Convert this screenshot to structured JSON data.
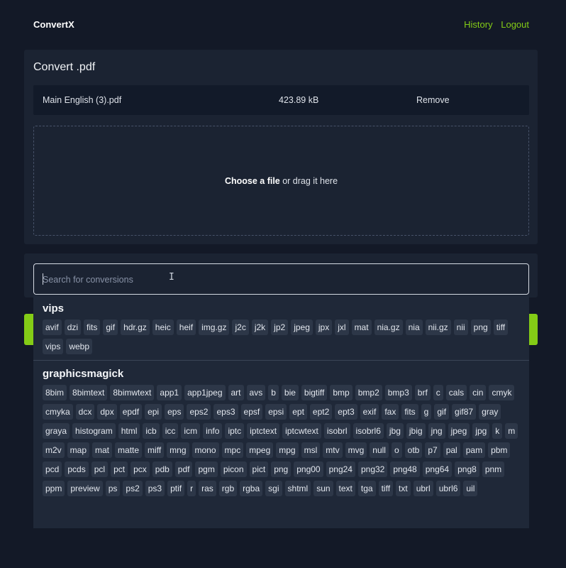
{
  "app": {
    "name": "ConvertX"
  },
  "nav": {
    "history": "History",
    "logout": "Logout"
  },
  "convert": {
    "title": "Convert .pdf",
    "file": {
      "name": "Main English (3).pdf",
      "size": "423.89 kB",
      "remove": "Remove"
    },
    "drop": {
      "choose": "Choose a file",
      "rest": " or drag it here"
    }
  },
  "search": {
    "placeholder": "Search for conversions"
  },
  "colors": {
    "accent": "#84cc16",
    "background": "#131927",
    "panel": "#1b2332"
  },
  "groups": [
    {
      "name": "vips",
      "formats": [
        "avif",
        "dzi",
        "fits",
        "gif",
        "hdr.gz",
        "heic",
        "heif",
        "img.gz",
        "j2c",
        "j2k",
        "jp2",
        "jpeg",
        "jpx",
        "jxl",
        "mat",
        "nia.gz",
        "nia",
        "nii.gz",
        "nii",
        "png",
        "tiff",
        "vips",
        "webp"
      ]
    },
    {
      "name": "graphicsmagick",
      "formats": [
        "8bim",
        "8bimtext",
        "8bimwtext",
        "app1",
        "app1jpeg",
        "art",
        "avs",
        "b",
        "bie",
        "bigtiff",
        "bmp",
        "bmp2",
        "bmp3",
        "brf",
        "c",
        "cals",
        "cin",
        "cmyk",
        "cmyka",
        "dcx",
        "dpx",
        "epdf",
        "epi",
        "eps",
        "eps2",
        "eps3",
        "epsf",
        "epsi",
        "ept",
        "ept2",
        "ept3",
        "exif",
        "fax",
        "fits",
        "g",
        "gif",
        "gif87",
        "gray",
        "graya",
        "histogram",
        "html",
        "icb",
        "icc",
        "icm",
        "info",
        "iptc",
        "iptctext",
        "iptcwtext",
        "isobrl",
        "isobrl6",
        "jbg",
        "jbig",
        "jng",
        "jpeg",
        "jpg",
        "k",
        "m",
        "m2v",
        "map",
        "mat",
        "matte",
        "miff",
        "mng",
        "mono",
        "mpc",
        "mpeg",
        "mpg",
        "msl",
        "mtv",
        "mvg",
        "null",
        "o",
        "otb",
        "p7",
        "pal",
        "pam",
        "pbm",
        "pcd",
        "pcds",
        "pcl",
        "pct",
        "pcx",
        "pdb",
        "pdf",
        "pgm",
        "picon",
        "pict",
        "png",
        "png00",
        "png24",
        "png32",
        "png48",
        "png64",
        "png8",
        "pnm",
        "ppm",
        "preview",
        "ps",
        "ps2",
        "ps3",
        "ptif",
        "r",
        "ras",
        "rgb",
        "rgba",
        "sgi",
        "shtml",
        "sun",
        "text",
        "tga",
        "tiff",
        "txt",
        "ubrl",
        "ubrl6",
        "uil"
      ]
    }
  ]
}
